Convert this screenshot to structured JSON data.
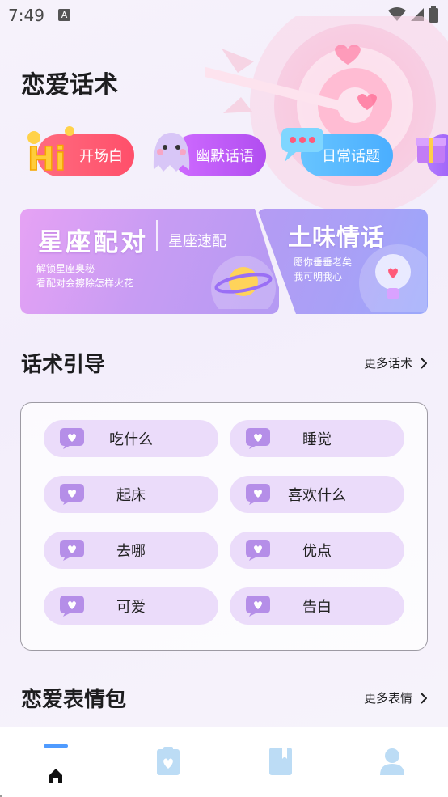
{
  "status_bar": {
    "time": "7:49",
    "notification_icon": "A"
  },
  "header": {
    "title": "恋爱话术"
  },
  "chips": [
    {
      "label": "开场白",
      "icon": "hi-icon",
      "color": "#ff5a70"
    },
    {
      "label": "幽默话语",
      "icon": "ghost-icon",
      "color": "#c05cf8"
    },
    {
      "label": "日常话题",
      "icon": "chat-bubble-icon",
      "color": "#57b8ff"
    },
    {
      "label": "",
      "icon": "gift-box-icon",
      "color": "#a86af8"
    }
  ],
  "feature_cards": {
    "left": {
      "title": "星座配对",
      "subtitle": "星座速配",
      "desc_line1": "解锁星座奥秘",
      "desc_line2": "看配对会擦除怎样火花"
    },
    "right": {
      "title": "土味情话",
      "desc_line1": "愿你垂垂老矣",
      "desc_line2": "我可明我心"
    }
  },
  "guide_section": {
    "title": "话术引导",
    "more_label": "更多话术",
    "topics": [
      "吃什么",
      "睡觉",
      "起床",
      "喜欢什么",
      "去哪",
      "优点",
      "可爱",
      "告白"
    ]
  },
  "sticker_section": {
    "title": "恋爱表情包",
    "more_label": "更多表情"
  },
  "tabbar": {
    "tabs": [
      "home-icon",
      "clipboard-heart-icon",
      "notebook-icon",
      "profile-icon"
    ],
    "active_color": "#4f9bff",
    "inactive_color": "#bcdcf5"
  }
}
